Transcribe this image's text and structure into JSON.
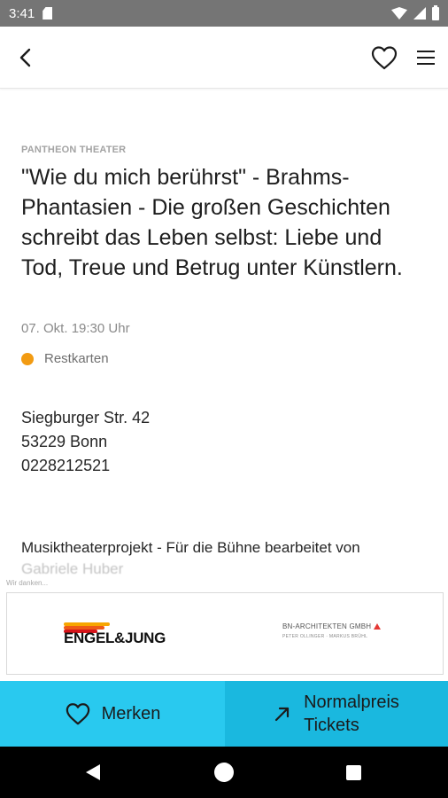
{
  "status_bar": {
    "time": "3:41",
    "icons": [
      "sd-card-icon",
      "wifi-icon",
      "cellular-icon",
      "battery-icon"
    ]
  },
  "app_bar": {
    "icons": [
      "back-arrow-icon",
      "heart-icon",
      "menu-icon"
    ]
  },
  "event": {
    "venue": "PANTHEON THEATER",
    "title": "\"Wie du mich berührst\" - Brahms-Phantasien - Die großen Geschichten schreibt das Leben selbst: Liebe und Tod, Treue und Betrug unter Künstlern.",
    "date": "07. Okt. 19:30 Uhr",
    "availability": {
      "label": "Restkarten",
      "color": "#f29b12"
    },
    "address": {
      "street": "Siegburger Str. 42",
      "city": "53229 Bonn",
      "phone": "0228212521"
    },
    "description": "Musiktheaterprojekt - Für die Bühne bearbeitet von",
    "description_more": "Gabriele Huber"
  },
  "sponsors": {
    "caption": "Wir danken...",
    "logos": [
      {
        "text": "ENGEL&JUNG",
        "icon": "engel-jung-logo"
      },
      {
        "text": "BN-ARCHITEKTEN GMBH",
        "subtext": "PETER OLLINGER · MARKUS BRÜHL",
        "icon": "bn-architekten-logo"
      }
    ]
  },
  "actions": {
    "merken_label": "Merken",
    "tickets_line1": "Normalpreis",
    "tickets_line2": "Tickets"
  },
  "colors": {
    "accent": "#29c9ef",
    "accent_dark": "#1ab8df",
    "status_dot": "#f29b12"
  },
  "nav_bar": {
    "icons": [
      "nav-back-icon",
      "nav-home-icon",
      "nav-recents-icon"
    ]
  }
}
